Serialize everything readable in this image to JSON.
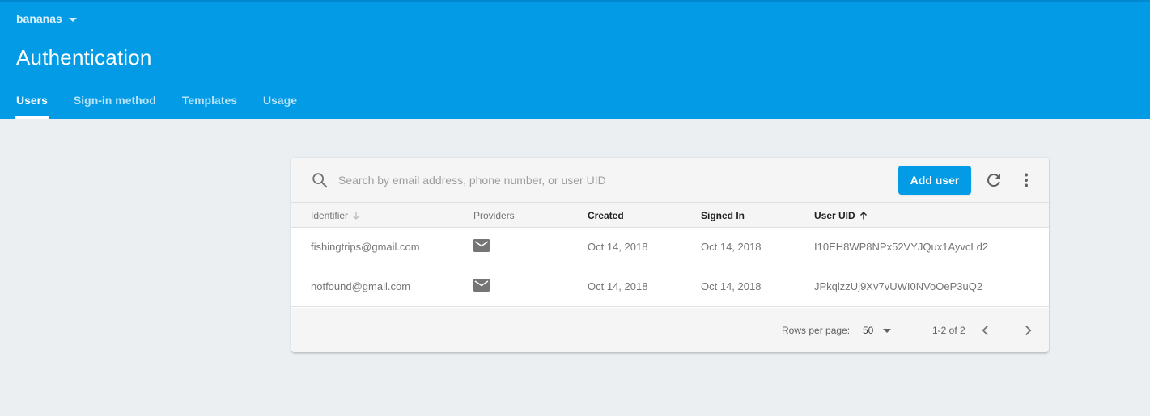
{
  "colors": {
    "header_bg": "#039be5",
    "page_bg": "#eceff1",
    "accent": "#039be5",
    "muted_text": "#757575"
  },
  "header": {
    "project_name": "bananas",
    "title": "Authentication",
    "tabs": [
      {
        "label": "Users",
        "active": true
      },
      {
        "label": "Sign-in method",
        "active": false
      },
      {
        "label": "Templates",
        "active": false
      },
      {
        "label": "Usage",
        "active": false
      }
    ]
  },
  "toolbar": {
    "search_placeholder": "Search by email address, phone number, or user UID",
    "search_value": "",
    "add_user_label": "Add user",
    "icons": [
      "search-icon",
      "refresh-icon",
      "more-vert-icon"
    ]
  },
  "table": {
    "columns": [
      "Identifier",
      "Providers",
      "Created",
      "Signed In",
      "User UID"
    ],
    "sort": {
      "column": "User UID",
      "direction": "ascending"
    },
    "rows": [
      {
        "identifier": "fishingtrips@gmail.com",
        "provider_icon": "mail-icon",
        "created": "Oct 14, 2018",
        "signed_in": "Oct 14, 2018",
        "uid": "I10EH8WP8NPx52VYJQux1AyvcLd2"
      },
      {
        "identifier": "notfound@gmail.com",
        "provider_icon": "mail-icon",
        "created": "Oct 14, 2018",
        "signed_in": "Oct 14, 2018",
        "uid": "JPkqlzzUj9Xv7vUWI0NVoOeP3uQ2"
      }
    ]
  },
  "footer": {
    "rows_per_page_label": "Rows per page:",
    "rows_per_page_value": "50",
    "range_label": "1-2 of 2"
  }
}
